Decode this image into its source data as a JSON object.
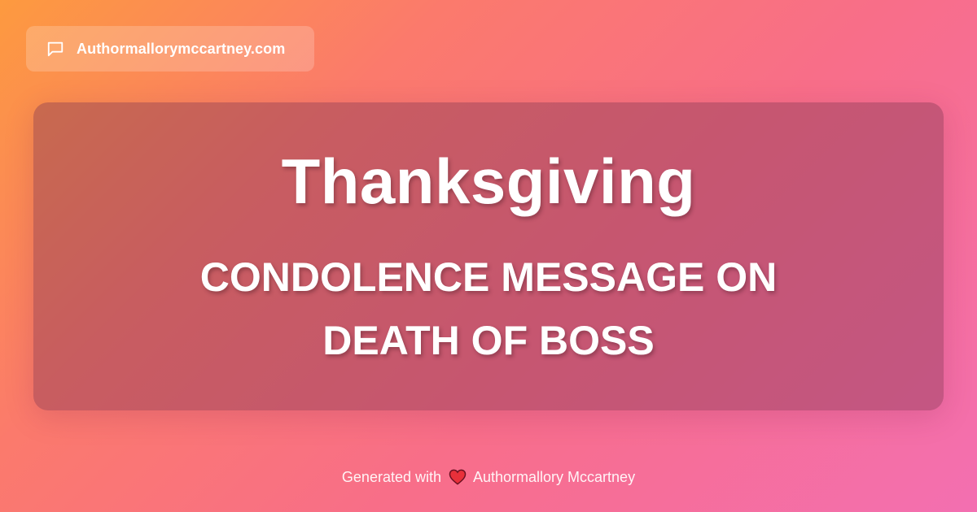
{
  "site": {
    "name": "Authormallorymccartney.com",
    "icon": "chat-bubble-icon"
  },
  "card": {
    "title": "Thanksgiving",
    "subtitle": "CONDOLENCE MESSAGE ON DEATH OF BOSS"
  },
  "footer": {
    "prefix": "Generated with",
    "icon": "heart-icon",
    "author": "Authormallory Mccartney"
  },
  "colors": {
    "gradient_start": "#fd9a3f",
    "gradient_mid": "#f86e89",
    "gradient_end": "#f36fb1",
    "heart": "#e8303a",
    "text": "#ffffff"
  }
}
